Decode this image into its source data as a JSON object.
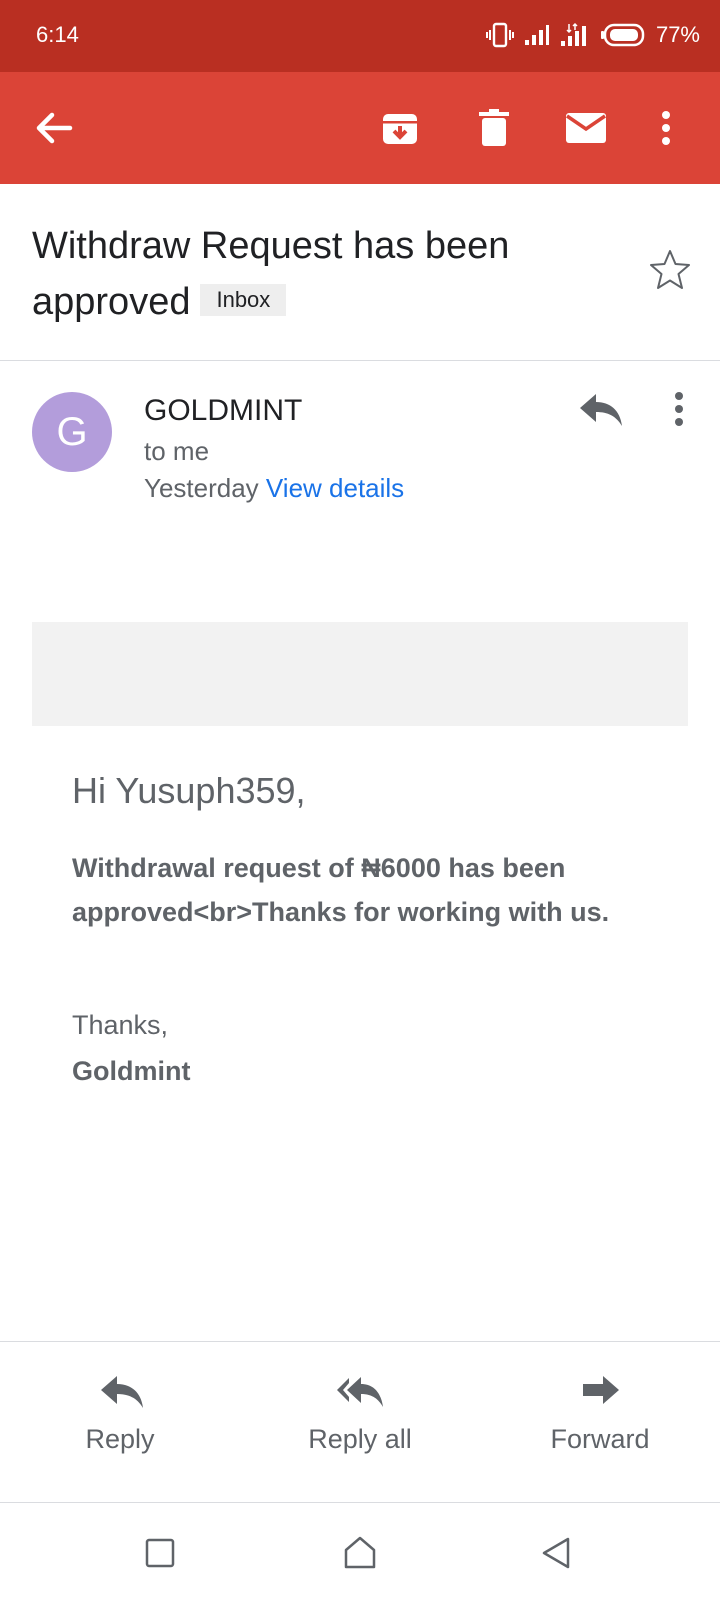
{
  "status_bar": {
    "time": "6:14",
    "battery": "77%",
    "icons": [
      "vibrate-icon",
      "signal-icon",
      "signal-data-icon",
      "battery-icon"
    ]
  },
  "toolbar": {
    "icons": [
      "back-arrow-icon",
      "archive-icon",
      "trash-icon",
      "mail-icon",
      "more-vert-icon"
    ],
    "color": "#db4437"
  },
  "email": {
    "subject": "Withdraw Request has been approved",
    "label": "Inbox",
    "sender_initial": "G",
    "sender": "GOLDMINT",
    "recipient": "to me",
    "date": "Yesterday",
    "details_link": "View details",
    "greeting": "Hi Yusuph359,",
    "body": "Withdrawal request of ₦6000 has been approved<br>Thanks for working with us.",
    "closing": "Thanks,",
    "signature": "Goldmint"
  },
  "actions": {
    "reply": "Reply",
    "reply_all": "Reply all",
    "forward": "Forward"
  },
  "colors": {
    "status_bar": "#b92f22",
    "accent": "#db4437",
    "link": "#1a73e8",
    "avatar": "#b39ddb"
  }
}
